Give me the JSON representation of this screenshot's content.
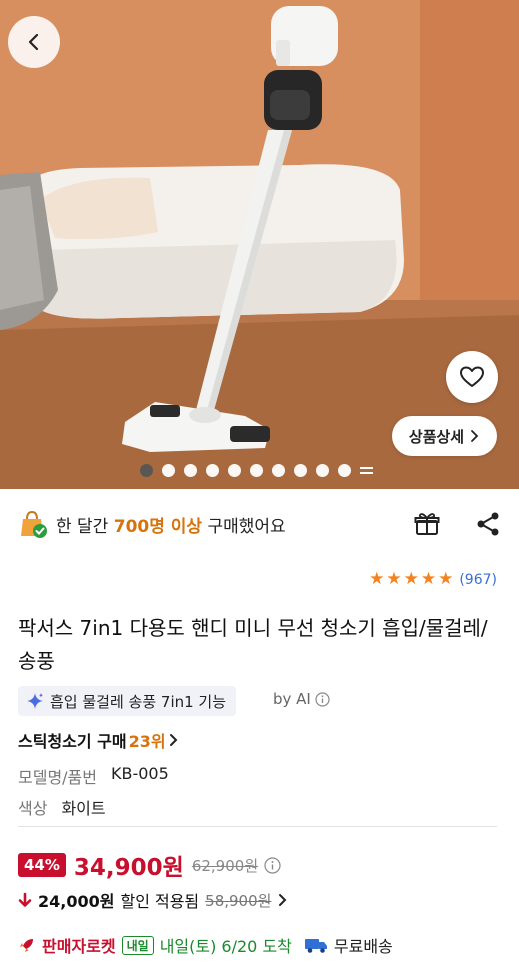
{
  "hero": {
    "back": "chevron-left-icon",
    "wish": "heart-icon",
    "detail_label": "상품상세",
    "slides": 11,
    "active_slide": 1
  },
  "social": {
    "prefix": "한 달간 ",
    "count": "700명 이상",
    "suffix": " 구매했어요"
  },
  "rating": {
    "stars": 5,
    "count": "(967)"
  },
  "product": {
    "title": "팍서스 7in1 다용도 핸디 미니 무선 청소기 흡입/물걸레/송풍",
    "ai_tag": "흡입 물걸레 송풍 7in1 기능",
    "by_ai": "by AI"
  },
  "rank": {
    "label": "스틱청소기 구매 ",
    "num": "23위"
  },
  "specs": [
    {
      "k": "모델명/품번",
      "v": "KB-005"
    },
    {
      "k": "색상",
      "v": "화이트"
    }
  ],
  "price": {
    "discount": "44%",
    "sale": "34,900원",
    "original": "62,900원"
  },
  "coupon": {
    "amount": "24,000원",
    "text": "할인 적용됨",
    "old": "58,900원"
  },
  "shipping": {
    "badge": "판매자로켓",
    "tomorrow": "내일",
    "eta": "내일(토) 6/20 도착",
    "free": "무료배송"
  },
  "colors": {
    "accent": "#d8720a",
    "price": "#c8102e",
    "green": "#1a8a2b",
    "link": "#3b6fd4"
  }
}
